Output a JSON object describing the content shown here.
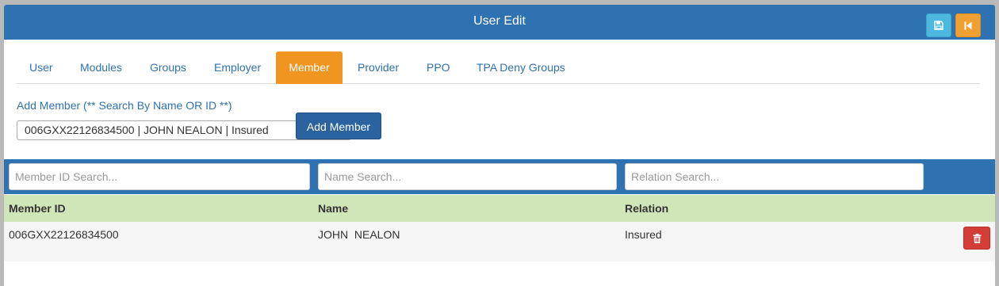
{
  "header": {
    "title": "User Edit",
    "save_icon": "floppy-disk-icon",
    "back_icon": "step-backward-icon"
  },
  "tabs": [
    {
      "label": "User",
      "active": false
    },
    {
      "label": "Modules",
      "active": false
    },
    {
      "label": "Groups",
      "active": false
    },
    {
      "label": "Employer",
      "active": false
    },
    {
      "label": "Member",
      "active": true
    },
    {
      "label": "Provider",
      "active": false
    },
    {
      "label": "PPO",
      "active": false
    },
    {
      "label": "TPA Deny Groups",
      "active": false
    }
  ],
  "add_member": {
    "label": "Add Member (** Search By Name OR ID **)",
    "selected_value": "006GXX22126834500 | JOHN NEALON | Insured",
    "button_label": "Add Member"
  },
  "search": {
    "member_id_placeholder": "Member ID Search...",
    "name_placeholder": "Name Search...",
    "relation_placeholder": "Relation Search..."
  },
  "table": {
    "columns": [
      "Member ID",
      "Name",
      "Relation"
    ],
    "rows": [
      {
        "member_id": "006GXX22126834500",
        "name": "JOHN  NEALON",
        "relation": "Insured",
        "delete_icon": "trash-icon"
      }
    ]
  },
  "colors": {
    "header_blue": "#2f72b1",
    "active_tab_orange": "#f0951f",
    "save_button": "#4cb8de",
    "back_button": "#f0a030",
    "table_header_green": "#d1e6b8",
    "delete_red": "#d43c36"
  }
}
